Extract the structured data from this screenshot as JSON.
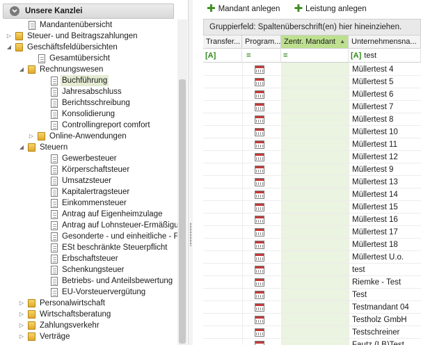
{
  "left_panel": {
    "title": "Unsere Kanzlei",
    "tree": [
      {
        "label": "Mandantenübersicht",
        "icon": "doc",
        "level": 1,
        "arrow": ""
      },
      {
        "label": "Steuer- und Beitragszahlungen",
        "icon": "folder",
        "level": 0,
        "arrow": "collapsed"
      },
      {
        "label": "Geschäftsfeldübersichten",
        "icon": "folder",
        "level": 0,
        "arrow": "expanded"
      },
      {
        "label": "Gesamtübersicht",
        "icon": "doc",
        "level": 2,
        "arrow": ""
      },
      {
        "label": "Rechnungswesen",
        "icon": "folder",
        "level": 1,
        "arrow": "expanded"
      },
      {
        "label": "Buchführung",
        "icon": "doc",
        "level": 3,
        "arrow": "",
        "selected": true
      },
      {
        "label": "Jahresabschluss",
        "icon": "doc",
        "level": 3,
        "arrow": ""
      },
      {
        "label": "Berichtsschreibung",
        "icon": "doc",
        "level": 3,
        "arrow": ""
      },
      {
        "label": "Konsolidierung",
        "icon": "doc",
        "level": 3,
        "arrow": ""
      },
      {
        "label": "Controllingreport comfort",
        "icon": "doc",
        "level": 3,
        "arrow": ""
      },
      {
        "label": "Online-Anwendungen",
        "icon": "folder",
        "level": 2,
        "arrow": "collapsed"
      },
      {
        "label": "Steuern",
        "icon": "folder",
        "level": 1,
        "arrow": "expanded"
      },
      {
        "label": "Gewerbesteuer",
        "icon": "doc",
        "level": 3,
        "arrow": ""
      },
      {
        "label": "Körperschaftsteuer",
        "icon": "doc",
        "level": 3,
        "arrow": ""
      },
      {
        "label": "Umsatzsteuer",
        "icon": "doc",
        "level": 3,
        "arrow": ""
      },
      {
        "label": "Kapitalertragsteuer",
        "icon": "doc",
        "level": 3,
        "arrow": ""
      },
      {
        "label": "Einkommensteuer",
        "icon": "doc",
        "level": 3,
        "arrow": ""
      },
      {
        "label": "Antrag auf Eigenheimzulage",
        "icon": "doc",
        "level": 3,
        "arrow": ""
      },
      {
        "label": "Antrag auf Lohnsteuer-Ermäßigung",
        "icon": "doc",
        "level": 3,
        "arrow": ""
      },
      {
        "label": "Gesonderte - und einheitliche - F...",
        "icon": "doc",
        "level": 3,
        "arrow": ""
      },
      {
        "label": "ESt beschränkte Steuerpflicht",
        "icon": "doc",
        "level": 3,
        "arrow": ""
      },
      {
        "label": "Erbschaftsteuer",
        "icon": "doc",
        "level": 3,
        "arrow": ""
      },
      {
        "label": "Schenkungsteuer",
        "icon": "doc",
        "level": 3,
        "arrow": ""
      },
      {
        "label": "Betriebs- und Anteilsbewertung",
        "icon": "doc",
        "level": 3,
        "arrow": ""
      },
      {
        "label": "EU-Vorsteuervergütung",
        "icon": "doc",
        "level": 3,
        "arrow": ""
      },
      {
        "label": "Personalwirtschaft",
        "icon": "folder",
        "level": 1,
        "arrow": "collapsed"
      },
      {
        "label": "Wirtschaftsberatung",
        "icon": "folder",
        "level": 1,
        "arrow": "collapsed"
      },
      {
        "label": "Zahlungsverkehr",
        "icon": "folder",
        "level": 1,
        "arrow": "collapsed"
      },
      {
        "label": "Verträge",
        "icon": "folder",
        "level": 1,
        "arrow": "collapsed"
      }
    ]
  },
  "toolbar": {
    "add_client_label": "Mandant anlegen",
    "add_service_label": "Leistung anlegen"
  },
  "grid": {
    "group_hint": "Gruppierfeld: Spaltenüberschrift(en) hier hineinziehen.",
    "columns": [
      "Transfer...",
      "Program...",
      "Zentr. Mandant",
      "Unternehmensna..."
    ],
    "filter_ops": [
      "[A]",
      "=",
      "=",
      "[A]"
    ],
    "filter_text": "test",
    "rows": [
      "Müllertest 4",
      "Müllertest 5",
      "Müllertest 6",
      "Müllertest 7",
      "Müllertest 8",
      "Müllertest 10",
      "Müllertest 11",
      "Müllertest 12",
      "Müllertest 9",
      "Müllertest 13",
      "Müllertest 14",
      "Müllertest 15",
      "Müllertest 16",
      "Müllertest 17",
      "Müllertest 18",
      "Müllertest U.o.",
      "test",
      "Riemke - Test",
      "Test",
      "Testmandant 04",
      "Testholz GmbH",
      "Testschreiner",
      "Fautz (LB)Test"
    ]
  },
  "colors": {
    "active_header": "#bde08f",
    "highlight_column": "#ebf3e1",
    "selected_tree_item": "#e4ecd3",
    "plus_icon": "#3d8f1e"
  }
}
